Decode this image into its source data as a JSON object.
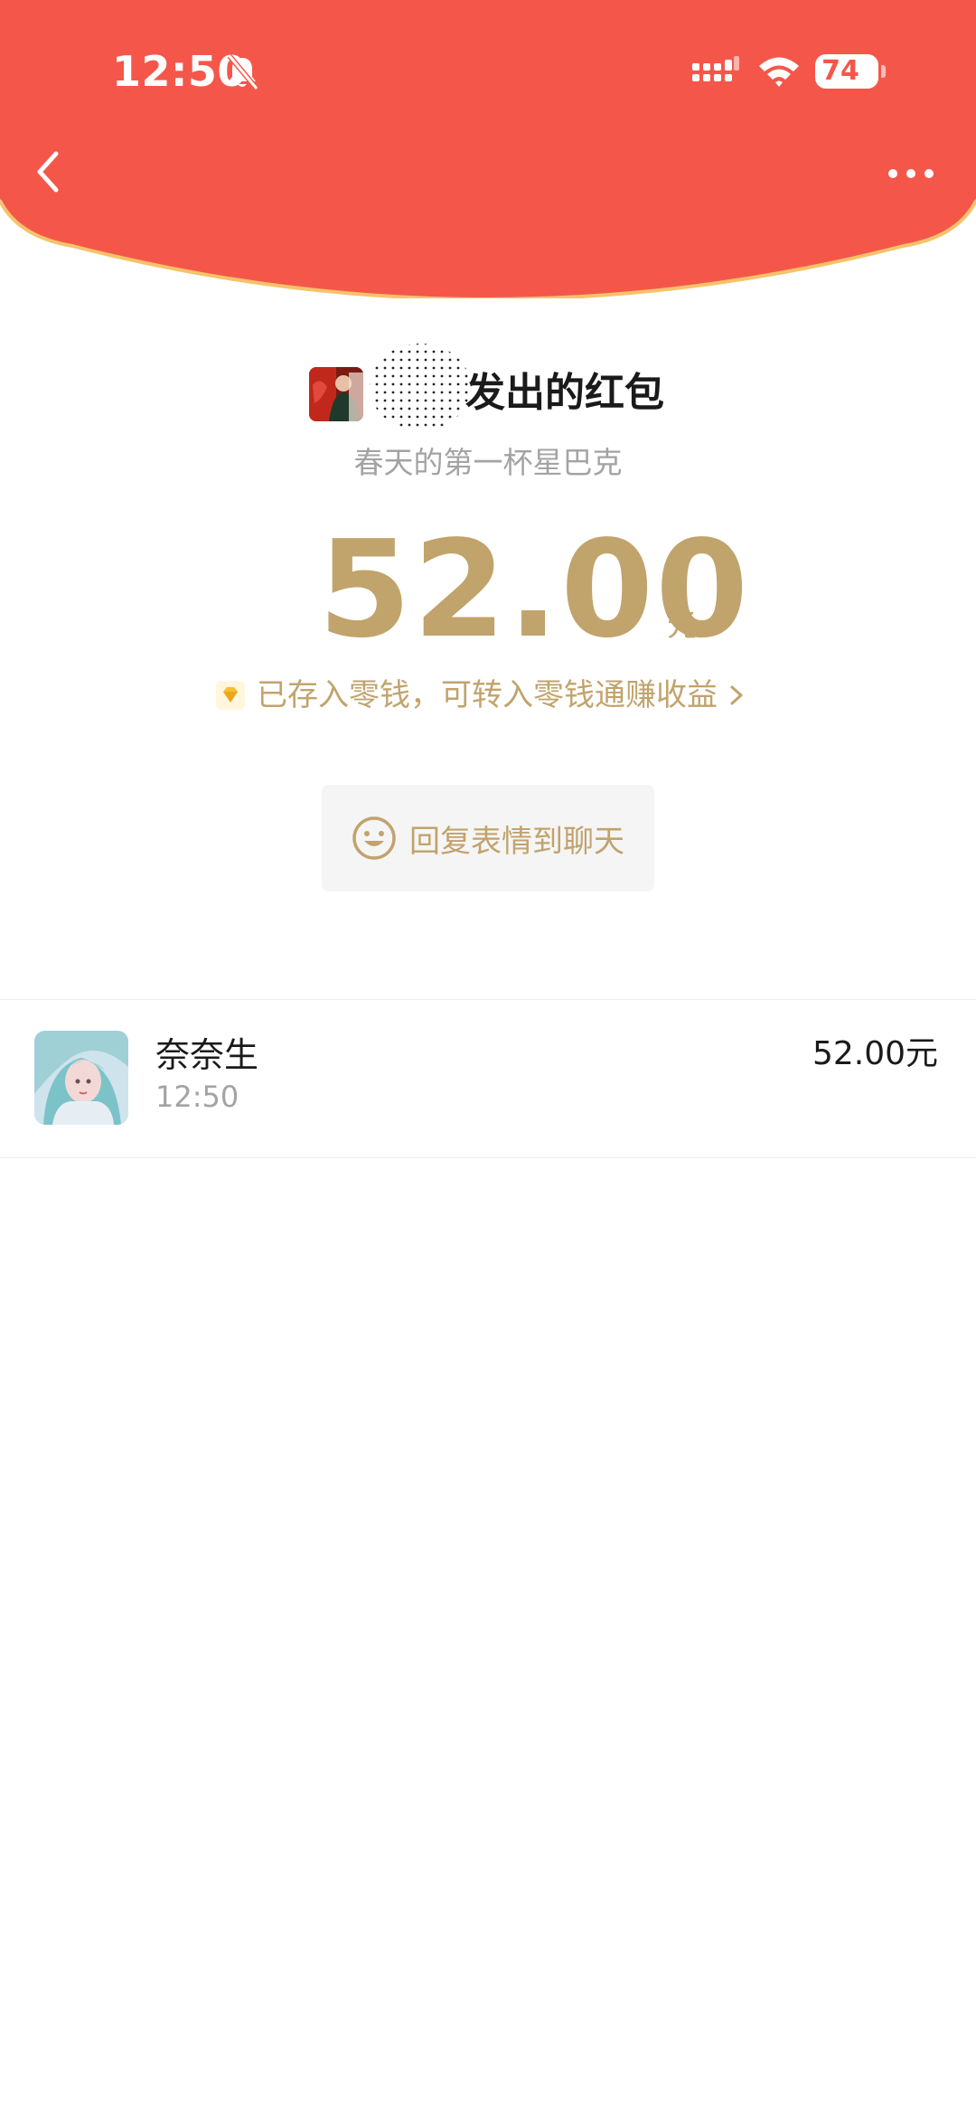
{
  "status_bar": {
    "time": "12:50",
    "battery": "74"
  },
  "header": {
    "background_color": "#f4574a",
    "border_color": "#f6c36a"
  },
  "sender": {
    "title_suffix": "发出的红包",
    "greeting": "春天的第一杯星巴克"
  },
  "packet": {
    "amount": "52.00",
    "unit": "元",
    "wallet_note": "已存入零钱，可转入零钱通赚收益",
    "accent_color": "#c1a36c"
  },
  "reply": {
    "label": "回复表情到聊天"
  },
  "receivers": [
    {
      "name": "奈奈生",
      "time": "12:50",
      "amount": "52.00元"
    }
  ]
}
